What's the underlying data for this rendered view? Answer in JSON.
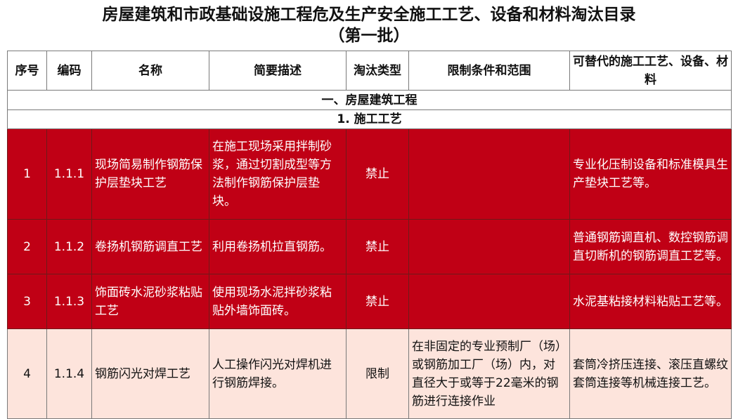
{
  "title": {
    "line1": "房屋建筑和市政基础设施工程危及生产安全施工工艺、设备和材料淘汰目录",
    "line2": "（第一批）"
  },
  "headers": {
    "seq": "序号",
    "code": "编码",
    "name": "名称",
    "desc": "简要描述",
    "type": "淘汰类型",
    "limit": "限制条件和范围",
    "alt": "可替代的施工工艺、设备、材料"
  },
  "section": "一、房屋建筑工程",
  "subsection": "1. 施工工艺",
  "colors": {
    "banned_row": "#c00015",
    "restricted_row": "#fde4dc",
    "section_text": "#1f5fb8"
  },
  "rows": [
    {
      "seq": "1",
      "code": "1.1.1",
      "name": "现场简易制作钢筋保护层垫块工艺",
      "desc": "在施工现场采用拌制砂浆，通过切割成型等方法制作钢筋保护层垫块。",
      "type": "禁止",
      "limit": "",
      "alt": "专业化压制设备和标准模具生产垫块工艺等。"
    },
    {
      "seq": "2",
      "code": "1.1.2",
      "name": "卷扬机钢筋调直工艺",
      "desc": "利用卷扬机拉直钢筋。",
      "type": "禁止",
      "limit": "",
      "alt": "普通钢筋调直机、数控钢筋调直切断机的钢筋调直工艺等。"
    },
    {
      "seq": "3",
      "code": "1.1.3",
      "name": "饰面砖水泥砂浆粘贴工艺",
      "desc": "使用现场水泥拌砂浆粘贴外墙饰面砖。",
      "type": "禁止",
      "limit": "",
      "alt": "水泥基粘接材料粘贴工艺等。"
    },
    {
      "seq": "4",
      "code": "1.1.4",
      "name": "钢筋闪光对焊工艺",
      "desc": "人工操作闪光对焊机进行钢筋焊接。",
      "type": "限制",
      "limit": "在非固定的专业预制厂（场）或钢筋加工厂（场）内，对直径大于或等于22毫米的钢筋进行连接作业",
      "alt": "套筒冷挤压连接、滚压直螺纹套筒连接等机械连接工艺。"
    }
  ]
}
